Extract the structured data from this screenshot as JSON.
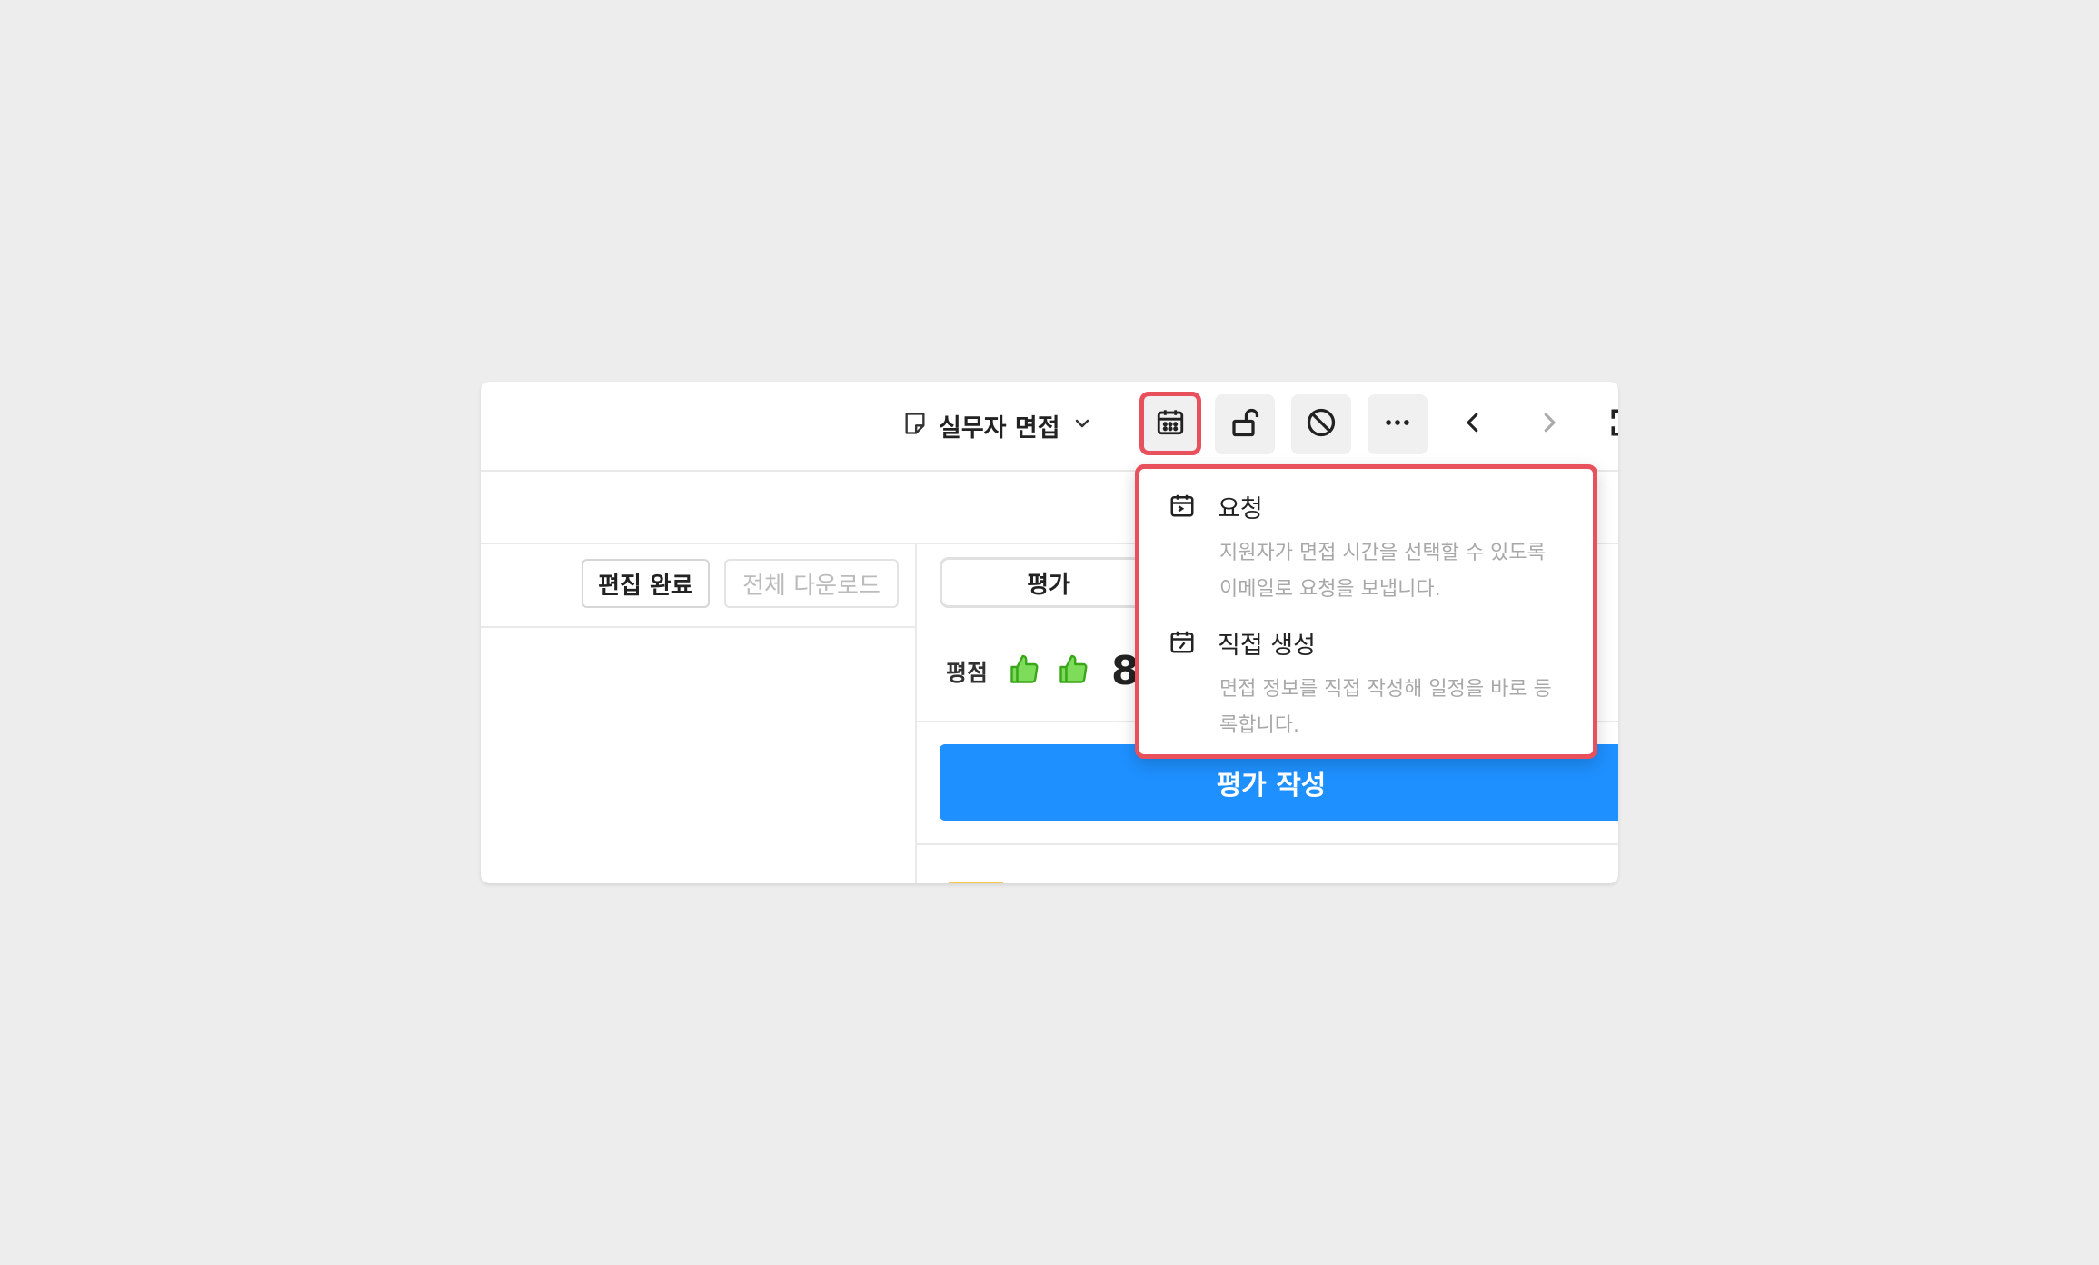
{
  "toolbar": {
    "stage_label": "실무자 면접",
    "icons": [
      "memo-icon",
      "chevron-down-icon",
      "calendar-icon",
      "unlock-icon",
      "block-icon",
      "more-icon",
      "chevron-left-icon",
      "chevron-right-icon",
      "expand-icon"
    ]
  },
  "actions": {
    "edit_done": "편집 완료",
    "download_all": "전체 다운로드"
  },
  "tabs": {
    "evaluation": "평가"
  },
  "rating": {
    "label": "평점",
    "score": "8",
    "thumbs_up_count": 2
  },
  "write_evaluation": "평가 작성",
  "schedule_menu": {
    "items": [
      {
        "icon": "calendar-request-icon",
        "title": "요청",
        "desc_line1": "지원자가 면접 시간을 선택할 수 있도록",
        "desc_line2": "이메일로 요청을 보냅니다."
      },
      {
        "icon": "calendar-edit-icon",
        "title": "직접 생성",
        "desc_line1": "면접 정보를 직접 작성해 일정을 바로 등",
        "desc_line2": "록합니다."
      }
    ]
  },
  "colors": {
    "background": "#ededed",
    "primary": "#1e90ff",
    "highlight": "#e8505b",
    "thumb": "#52c41a"
  }
}
